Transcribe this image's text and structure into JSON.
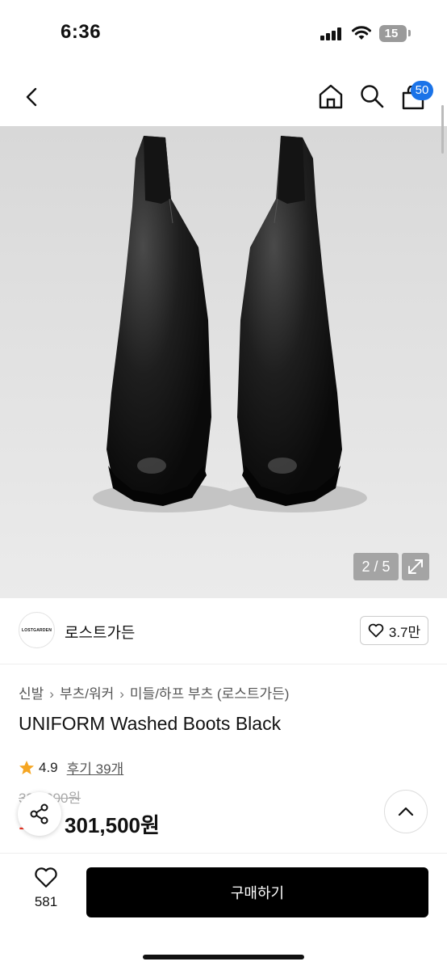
{
  "status_bar": {
    "time": "6:36",
    "battery": "15"
  },
  "nav": {
    "cart_count": "50"
  },
  "gallery": {
    "counter": "2 / 5"
  },
  "brand": {
    "logo_text": "LOSTGARDEN",
    "name": "로스트가든",
    "likes": "3.7만"
  },
  "breadcrumb": {
    "items": [
      "신발",
      "부츠/워커",
      "미들/하프 부츠 (로스트가든)"
    ]
  },
  "product": {
    "title": "UNIFORM Washed Boots Black",
    "rating": "4.9",
    "reviews": "후기 39개",
    "original_price": "335,000원",
    "discount": "10%",
    "sale_price": "301,500원"
  },
  "bottom": {
    "wish_count": "581",
    "buy_label": "구매하기"
  },
  "colors": {
    "badge": "#1a73e8",
    "star": "#f5a623",
    "discount": "#e32",
    "buy": "#000000"
  }
}
